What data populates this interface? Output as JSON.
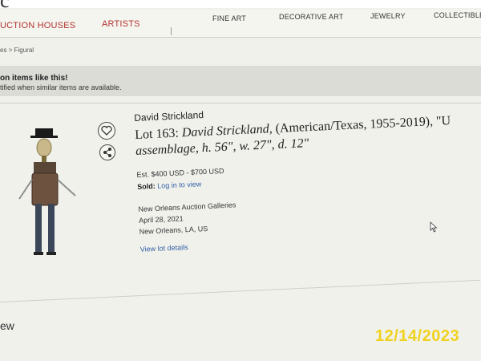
{
  "nav": {
    "auction_houses": "UCTION HOUSES",
    "artists": "ARTISTS",
    "fine_art": "FINE ART",
    "decorative_art": "DECORATIVE ART",
    "jewelry": "JEWELRY",
    "collectibles": "COLLECTIBLES"
  },
  "breadcrumb": {
    "prefix": "es",
    "separator": ">",
    "current": "Figural"
  },
  "banner": {
    "title": "on items like this!",
    "subtitle": "tified when similar items are available."
  },
  "lot": {
    "artist": "David Strickland",
    "title_prefix": "Lot 163: ",
    "title_italic": "David Strickland,",
    "title_rest": " (American/Texas, 1955-2019), \"U",
    "title_line2": "assemblage, h. 56\", w. 27\", d. 12\"",
    "estimate": "Est. $400 USD - $700 USD",
    "sold_label": "Sold:",
    "sold_link": "Log in to view",
    "auction_house": "New Orleans Auction Galleries",
    "date": "April 28, 2021",
    "location": "New Orleans, LA, US",
    "view_details": "View lot details"
  },
  "bottom_fragment": "ew",
  "date_stamp": "12/14/2023",
  "icons": {
    "heart": "heart-icon",
    "share": "share-icon",
    "cursor": "mouse-cursor-icon"
  },
  "colors": {
    "accent_red": "#b3322f",
    "link_blue": "#2f5fa5",
    "date_stamp_yellow": "#f0d21e"
  }
}
